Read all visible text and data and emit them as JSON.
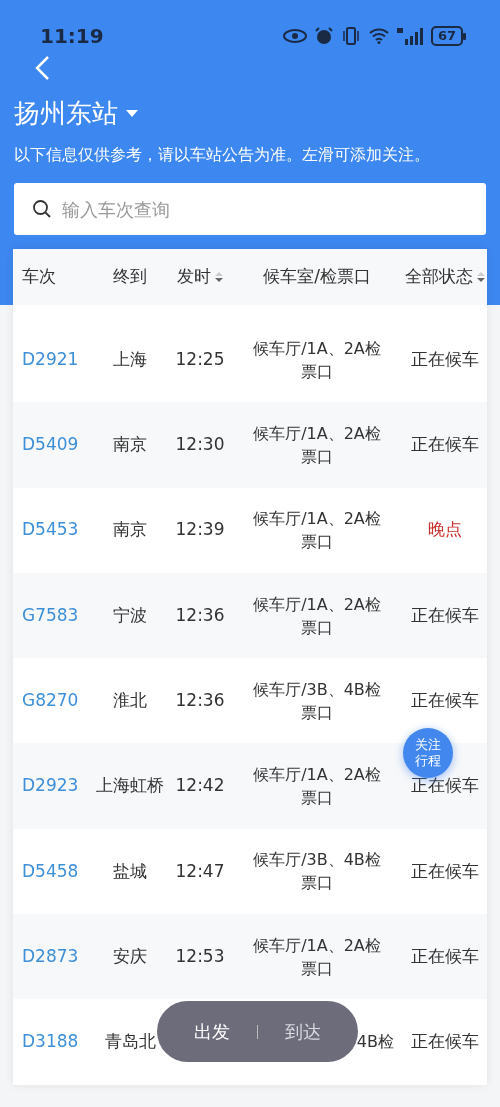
{
  "status_bar": {
    "time": "11:19",
    "battery": "67"
  },
  "station": {
    "name": "扬州东站"
  },
  "notice": "以下信息仅供参考，请以车站公告为准。左滑可添加关注。",
  "search": {
    "placeholder": "输入车次查询"
  },
  "table": {
    "columns": [
      {
        "label": "车次",
        "sortable": false
      },
      {
        "label": "终到",
        "sortable": false
      },
      {
        "label": "发时",
        "sortable": true
      },
      {
        "label": "候车室/检票口",
        "sortable": false
      },
      {
        "label": "全部状态",
        "sortable": true
      }
    ],
    "rows": [
      {
        "train": "D2921",
        "destination": "上海",
        "time": "12:25",
        "gate": "候车厅/1A、2A检票口",
        "status": "正在候车",
        "late": false
      },
      {
        "train": "D5409",
        "destination": "南京",
        "time": "12:30",
        "gate": "候车厅/1A、2A检票口",
        "status": "正在候车",
        "late": false
      },
      {
        "train": "D5453",
        "destination": "南京",
        "time": "12:39",
        "gate": "候车厅/1A、2A检票口",
        "status": "晚点",
        "late": true
      },
      {
        "train": "G7583",
        "destination": "宁波",
        "time": "12:36",
        "gate": "候车厅/1A、2A检票口",
        "status": "正在候车",
        "late": false
      },
      {
        "train": "G8270",
        "destination": "淮北",
        "time": "12:36",
        "gate": "候车厅/3B、4B检票口",
        "status": "正在候车",
        "late": false
      },
      {
        "train": "D2923",
        "destination": "上海虹桥",
        "time": "12:42",
        "gate": "候车厅/1A、2A检票口",
        "status": "正在候车",
        "late": false
      },
      {
        "train": "D5458",
        "destination": "盐城",
        "time": "12:47",
        "gate": "候车厅/3B、4B检票口",
        "status": "正在候车",
        "late": false
      },
      {
        "train": "D2873",
        "destination": "安庆",
        "time": "12:53",
        "gate": "候车厅/1A、2A检票口",
        "status": "正在候车",
        "late": false
      },
      {
        "train": "D3188",
        "destination": "青岛北",
        "gate": "4B检",
        "status": "正在候车",
        "late": false
      }
    ]
  },
  "follow_button": "关注行程",
  "mode_toggle": [
    {
      "label": "出发",
      "selected": true
    },
    {
      "label": "到达",
      "selected": false
    }
  ]
}
